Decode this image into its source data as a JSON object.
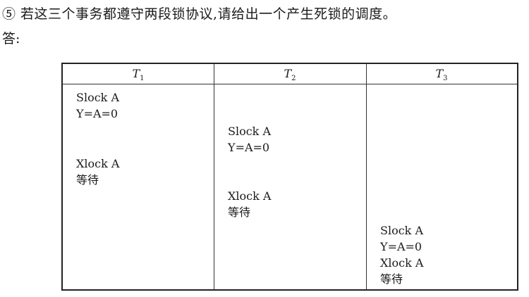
{
  "question": "⑤ 若这三个事务都遵守两段锁协议,请给出一个产生死锁的调度。",
  "answer_label": "答:",
  "table": {
    "headers": [
      {
        "name": "T",
        "sub": "1"
      },
      {
        "name": "T",
        "sub": "2"
      },
      {
        "name": "T",
        "sub": "3"
      }
    ],
    "t1": {
      "slock_a": "Slock A",
      "assign": "Y=A=0",
      "xlock_a": "Xlock A",
      "wait": "等待"
    },
    "t2": {
      "slock_a": "Slock A",
      "assign": "Y=A=0",
      "xlock_a": "Xlock A",
      "wait": "等待"
    },
    "t3": {
      "slock_a": "Slock A",
      "assign": "Y=A=0",
      "xlock_a": "Xlock A",
      "wait": "等待"
    }
  }
}
